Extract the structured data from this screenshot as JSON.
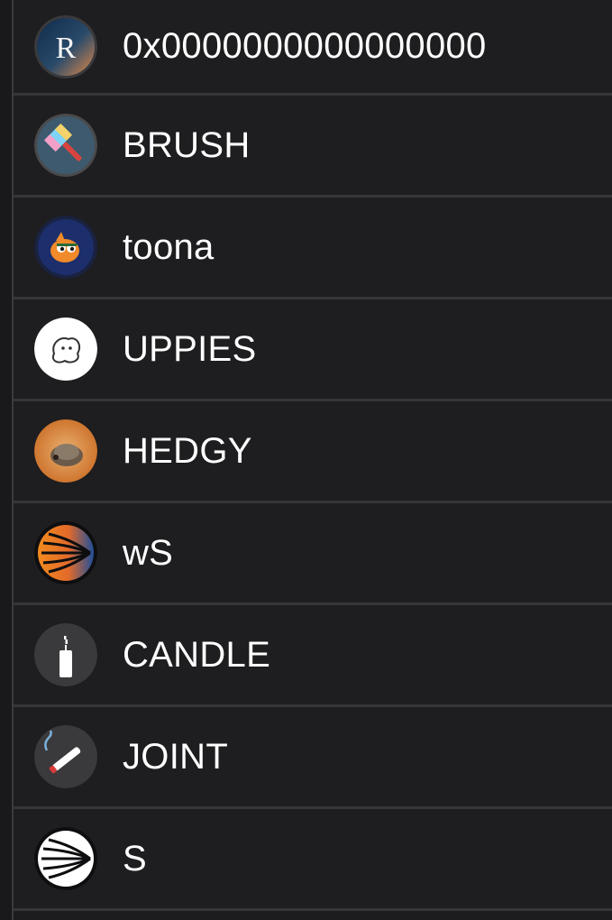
{
  "tokens": [
    {
      "symbol": "0x0000000000000000",
      "icon": "r-logo-icon"
    },
    {
      "symbol": "BRUSH",
      "icon": "paintbrush-icon"
    },
    {
      "symbol": "toona",
      "icon": "fish-mascot-icon"
    },
    {
      "symbol": "UPPIES",
      "icon": "ghost-sketch-icon"
    },
    {
      "symbol": "HEDGY",
      "icon": "hedgehog-photo-icon"
    },
    {
      "symbol": "wS",
      "icon": "sonic-orange-icon"
    },
    {
      "symbol": "CANDLE",
      "icon": "candle-icon"
    },
    {
      "symbol": "JOINT",
      "icon": "joint-icon"
    },
    {
      "symbol": "S",
      "icon": "sonic-white-icon"
    }
  ]
}
